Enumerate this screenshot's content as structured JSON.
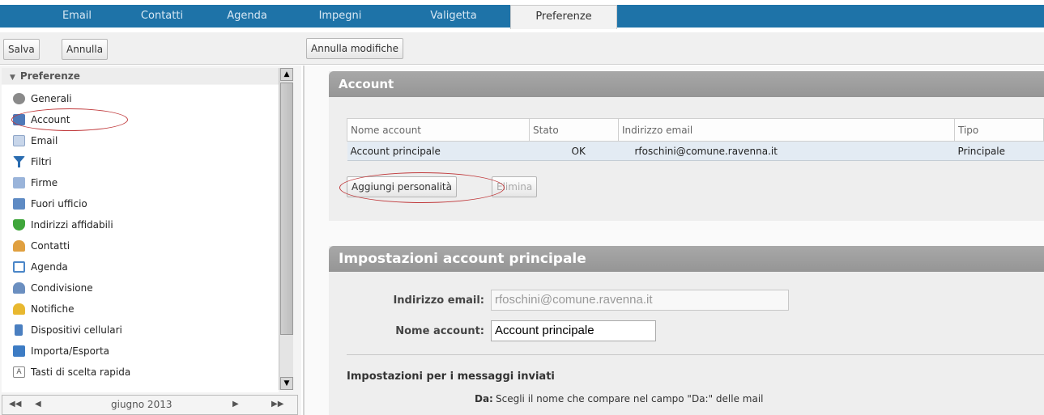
{
  "tabs": [
    "Email",
    "Contatti",
    "Agenda",
    "Impegni",
    "Valigetta",
    "Preferenze"
  ],
  "left_toolbar": {
    "save": "Salva",
    "cancel": "Annulla"
  },
  "right_toolbar": {
    "undo": "Annulla modifiche"
  },
  "sidebar": {
    "header": "Preferenze",
    "items": [
      {
        "label": "Generali",
        "icon": "gear-icon",
        "color": "#8a8a8a"
      },
      {
        "label": "Account",
        "icon": "account-icon",
        "color": "#4f79b8",
        "selected": true
      },
      {
        "label": "Email",
        "icon": "envelope-icon",
        "color": "#9fb4d3"
      },
      {
        "label": "Filtri",
        "icon": "filter-icon",
        "color": "#2a6cb0"
      },
      {
        "label": "Firme",
        "icon": "signature-icon",
        "color": "#7a9ac8"
      },
      {
        "label": "Fuori ufficio",
        "icon": "out-of-office-icon",
        "color": "#5f8bc4"
      },
      {
        "label": "Indirizzi affidabili",
        "icon": "shield-check-icon",
        "color": "#3fa63b"
      },
      {
        "label": "Contatti",
        "icon": "contact-icon",
        "color": "#e0a040"
      },
      {
        "label": "Agenda",
        "icon": "calendar-icon",
        "color": "#4a86c8"
      },
      {
        "label": "Condivisione",
        "icon": "share-icon",
        "color": "#6b8fc0"
      },
      {
        "label": "Notifiche",
        "icon": "bell-icon",
        "color": "#e8b830"
      },
      {
        "label": "Dispositivi cellulari",
        "icon": "phone-icon",
        "color": "#4a7fc0"
      },
      {
        "label": "Importa/Esporta",
        "icon": "import-export-icon",
        "color": "#3d7cc4"
      },
      {
        "label": "Tasti di scelta rapida",
        "icon": "keyboard-icon",
        "color": "#bbbbbb"
      }
    ]
  },
  "minical": {
    "month": "giugno 2013"
  },
  "account_panel": {
    "title": "Account",
    "columns": [
      "Nome account",
      "Stato",
      "Indirizzo email",
      "Tipo"
    ],
    "rows": [
      {
        "name": "Account principale",
        "status": "OK",
        "email": "rfoschini@comune.ravenna.it",
        "type": "Principale"
      }
    ],
    "add_button": "Aggiungi personalità",
    "delete_button": "Elimina"
  },
  "settings_panel": {
    "title": "Impostazioni account principale",
    "email_label": "Indirizzo email:",
    "email_value": "rfoschini@comune.ravenna.it",
    "name_label": "Nome account:",
    "name_value": "Account principale",
    "sent_heading": "Impostazioni per i messaggi inviati",
    "from_label": "Da:",
    "from_hint": "Scegli il nome che compare nel campo \"Da:\" delle mail"
  },
  "colors": {
    "tabbar": "#1e73a8",
    "panel_header": "#9b9b9b",
    "highlight_oval": "#c0393b"
  }
}
